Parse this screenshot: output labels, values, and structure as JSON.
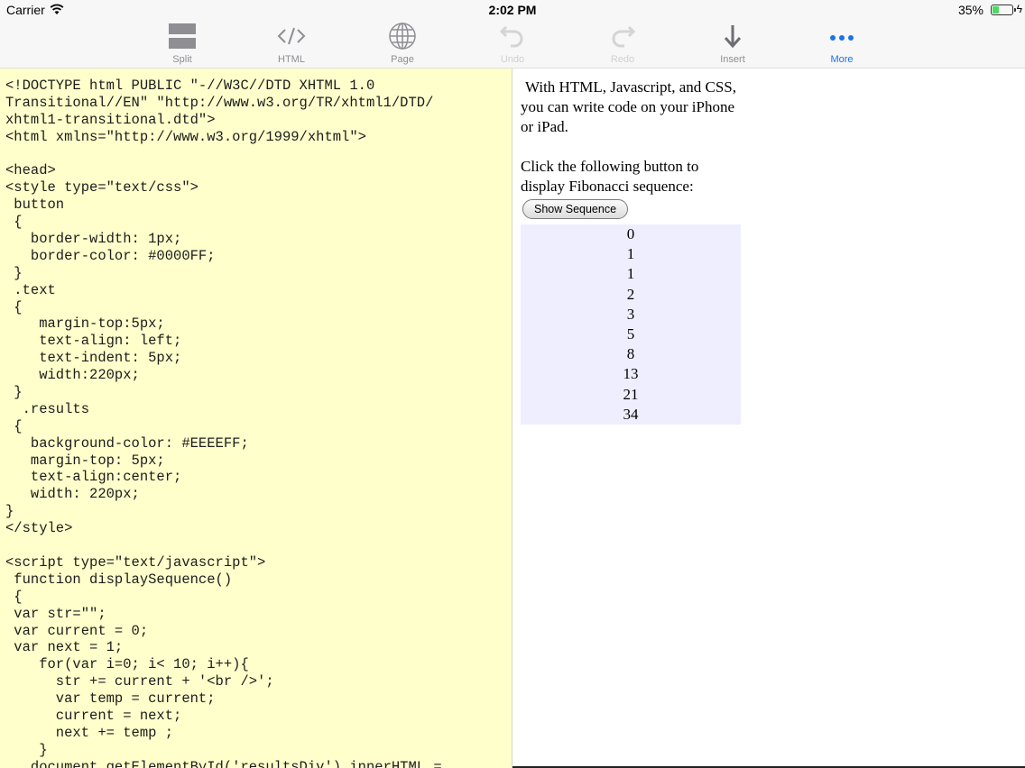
{
  "status": {
    "carrier": "Carrier",
    "time": "2:02 PM",
    "battery_percent": "35%",
    "battery_level": 0.35
  },
  "toolbar": {
    "items": [
      {
        "label": "Split",
        "icon": "split-icon",
        "state": "normal"
      },
      {
        "label": "HTML",
        "icon": "code-icon",
        "state": "normal"
      },
      {
        "label": "Page",
        "icon": "globe-icon",
        "state": "normal"
      },
      {
        "label": "Undo",
        "icon": "undo-icon",
        "state": "disabled"
      },
      {
        "label": "Redo",
        "icon": "redo-icon",
        "state": "disabled"
      },
      {
        "label": "Insert",
        "icon": "insert-arrow-icon",
        "state": "normal"
      },
      {
        "label": "More",
        "icon": "more-dots-icon",
        "state": "active"
      }
    ]
  },
  "editor": {
    "lines": [
      "<!DOCTYPE html PUBLIC \"-//W3C//DTD XHTML 1.0",
      "Transitional//EN\" \"http://www.w3.org/TR/xhtml1/DTD/",
      "xhtml1-transitional.dtd\">",
      "<html xmlns=\"http://www.w3.org/1999/xhtml\">",
      "",
      "<head>",
      "<style type=\"text/css\">",
      " button",
      " {",
      "   border-width: 1px;",
      "   border-color: #0000FF;",
      " }",
      " .text",
      " {",
      "    margin-top:5px;",
      "    text-align: left;",
      "    text-indent: 5px;",
      "    width:220px;",
      " }",
      "  .results",
      " {",
      "   background-color: #EEEEFF;",
      "   margin-top: 5px;",
      "   text-align:center;",
      "   width: 220px;",
      "}",
      "</style>",
      "",
      "<script type=\"text/javascript\">",
      " function displaySequence()",
      " {",
      " var str=\"\";",
      " var current = 0;",
      " var next = 1;",
      "    for(var i=0; i< 10; i++){",
      "      str += current + '<br />';",
      "      var temp = current;",
      "      current = next;",
      "      next += temp ;",
      "    }",
      "   document.getElementById('resultsDiv').innerHTML ="
    ]
  },
  "preview": {
    "paragraph1": "With HTML, Javascript, and CSS, you can write code on your iPhone or iPad.",
    "paragraph2": "Click the following button to display Fibonacci sequence:",
    "button_label": "Show Sequence",
    "results": [
      "0",
      "1",
      "1",
      "2",
      "3",
      "5",
      "8",
      "13",
      "21",
      "34"
    ],
    "results_background": "#eeeeff"
  },
  "colors": {
    "editor_background": "#ffffcc",
    "toolbar_active": "#1a73e8",
    "battery_fill": "#4cd964"
  }
}
